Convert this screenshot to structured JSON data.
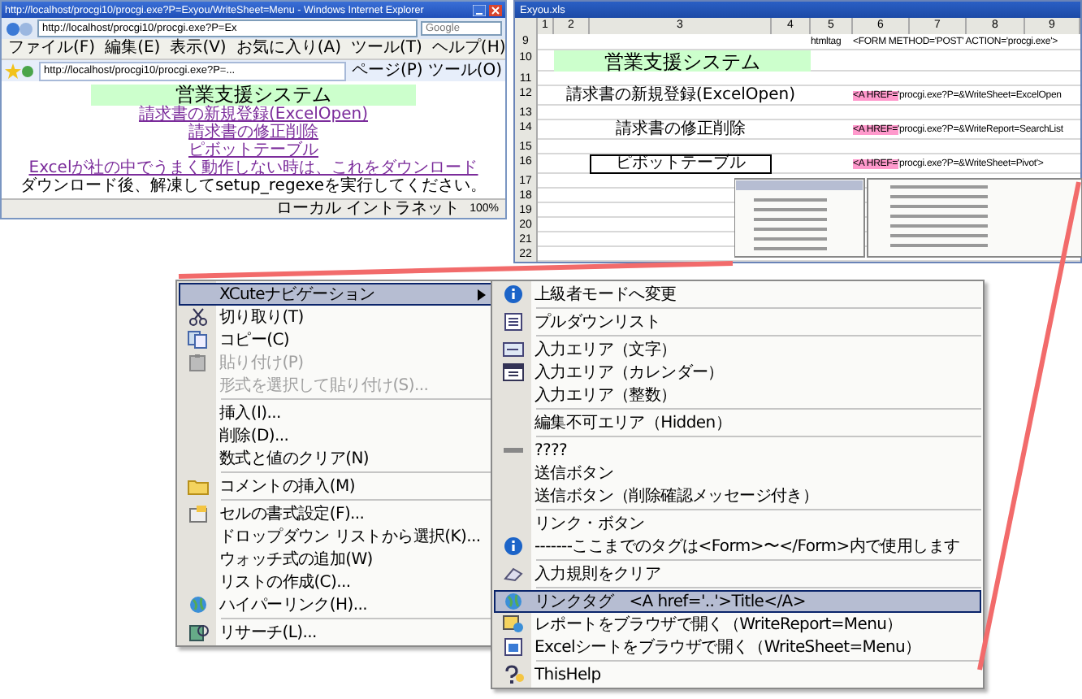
{
  "browser": {
    "title": "http://localhost/procgi10/procgi.exe?P=Exyou/WriteSheet=Menu - Windows Internet Explorer",
    "address": "http://localhost/procgi10/procgi.exe?P=Ex",
    "search_placeholder": "Google",
    "menu": [
      "ファイル(F)",
      "編集(E)",
      "表示(V)",
      "お気に入り(A)",
      "ツール(T)",
      "ヘルプ(H)"
    ],
    "tab": "http://localhost/procgi10/procgi.exe?P=...",
    "toolbar": [
      "ページ(P)",
      "ツール(O)"
    ],
    "page": {
      "heading": "営業支援システム",
      "links": [
        "請求書の新規登録(ExcelOpen)",
        "請求書の修正削除",
        "ピボットテーブル",
        "Excelが社の中でうまく動作しない時は、これをダウンロード"
      ],
      "note": "ダウンロード後、解凍してsetup_regexeを実行してください。"
    },
    "status": "ローカル イントラネット",
    "zoom": "100%"
  },
  "sheet": {
    "title": "Exyou.xls",
    "columns": [
      "1",
      "2",
      "3",
      "4",
      "5",
      "6",
      "7",
      "8",
      "9"
    ],
    "rows": [
      {
        "number": "9",
        "cells": [
          "",
          "",
          "",
          "",
          {
            "kind": "plain",
            "text": "htmltag"
          },
          {
            "kind": "plain",
            "text": "<FORM METHOD='POST' ACTION='procgi.exe'>"
          },
          "",
          "",
          ""
        ]
      },
      {
        "number": "10",
        "cells": [
          "",
          "",
          {
            "kind": "heading",
            "text": "営業支援システム"
          },
          "",
          "",
          "",
          "",
          "",
          ""
        ]
      },
      {
        "number": "11",
        "cells": []
      },
      {
        "number": "12",
        "cells": [
          "",
          "",
          {
            "kind": "center",
            "text": "請求書の新規登録(ExcelOpen)"
          },
          "",
          "",
          {
            "kind": "tag",
            "tag": "<A HREF='",
            "text": "procgi.exe?P=&WriteSheet=ExcelOpen"
          },
          "",
          "",
          ""
        ]
      },
      {
        "number": "13",
        "cells": []
      },
      {
        "number": "14",
        "cells": [
          "",
          "",
          {
            "kind": "center",
            "text": "請求書の修正削除"
          },
          "",
          "",
          {
            "kind": "tag",
            "tag": "<A HREF='",
            "text": "procgi.exe?P=&WriteReport=SearchList"
          },
          "",
          "",
          ""
        ]
      },
      {
        "number": "15",
        "cells": []
      },
      {
        "number": "16",
        "cells": [
          "",
          "",
          {
            "kind": "boxed",
            "text": "ピボットテーブル"
          },
          "",
          "",
          {
            "kind": "tag",
            "tag": "<A HREF='",
            "text": "procgi.exe?P=&WriteSheet=Pivot'>"
          },
          "",
          "",
          ""
        ]
      },
      {
        "number": "17",
        "cells": []
      },
      {
        "number": "18",
        "cells": []
      },
      {
        "number": "19",
        "cells": []
      },
      {
        "number": "20",
        "cells": []
      },
      {
        "number": "21",
        "cells": []
      },
      {
        "number": "22",
        "cells": []
      }
    ]
  },
  "context_menu": {
    "groups": [
      [
        {
          "label": "XCuteナビゲーション",
          "selected": true,
          "disabled": false,
          "submenu": true
        },
        {
          "label": "切り取り(T)",
          "selected": false,
          "disabled": false,
          "submenu": false
        },
        {
          "label": "コピー(C)",
          "selected": false,
          "disabled": false,
          "submenu": false
        },
        {
          "label": "貼り付け(P)",
          "selected": false,
          "disabled": true,
          "submenu": false
        },
        {
          "label": "形式を選択して貼り付け(S)...",
          "selected": false,
          "disabled": true,
          "submenu": false
        }
      ],
      [
        {
          "label": "挿入(I)...",
          "selected": false,
          "disabled": false,
          "submenu": false
        },
        {
          "label": "削除(D)...",
          "selected": false,
          "disabled": false,
          "submenu": false
        },
        {
          "label": "数式と値のクリア(N)",
          "selected": false,
          "disabled": false,
          "submenu": false
        }
      ],
      [
        {
          "label": "コメントの挿入(M)",
          "selected": false,
          "disabled": false,
          "submenu": false
        }
      ],
      [
        {
          "label": "セルの書式設定(F)...",
          "selected": false,
          "disabled": false,
          "submenu": false
        },
        {
          "label": "ドロップダウン リストから選択(K)...",
          "selected": false,
          "disabled": false,
          "submenu": false
        },
        {
          "label": "ウォッチ式の追加(W)",
          "selected": false,
          "disabled": false,
          "submenu": false
        },
        {
          "label": "リストの作成(C)...",
          "selected": false,
          "disabled": false,
          "submenu": false
        },
        {
          "label": "ハイパーリンク(H)...",
          "selected": false,
          "disabled": false,
          "submenu": false
        }
      ],
      [
        {
          "label": "リサーチ(L)...",
          "selected": false,
          "disabled": false,
          "submenu": false
        }
      ]
    ]
  },
  "submenu": {
    "groups": [
      [
        {
          "label": "上級者モードへ変更",
          "selected": false
        }
      ],
      [
        {
          "label": "プルダウンリスト",
          "selected": false
        }
      ],
      [
        {
          "label": "入力エリア（文字）",
          "selected": false
        },
        {
          "label": "入力エリア（カレンダー）",
          "selected": false
        },
        {
          "label": "入力エリア（整数）",
          "selected": false
        }
      ],
      [
        {
          "label": "編集不可エリア（Hidden）",
          "selected": false
        }
      ],
      [
        {
          "label": "????",
          "selected": false
        },
        {
          "label": "送信ボタン",
          "selected": false
        },
        {
          "label": "送信ボタン（削除確認メッセージ付き）",
          "selected": false
        }
      ],
      [
        {
          "label": "リンク・ボタン",
          "selected": false
        },
        {
          "label": "-------ここまでのタグは<Form>〜</Form>内で使用します",
          "selected": false
        }
      ],
      [
        {
          "label": "入力規則をクリア",
          "selected": false
        }
      ],
      [
        {
          "label": "リンクタグ　<A href='..'>Title</A>",
          "selected": true
        },
        {
          "label": "レポートをブラウザで開く（WriteReport=Menu）",
          "selected": false
        },
        {
          "label": "Excelシートをブラウザで開く（WriteSheet=Menu）",
          "selected": false
        }
      ],
      [
        {
          "label": "ThisHelp",
          "selected": false
        }
      ]
    ]
  }
}
